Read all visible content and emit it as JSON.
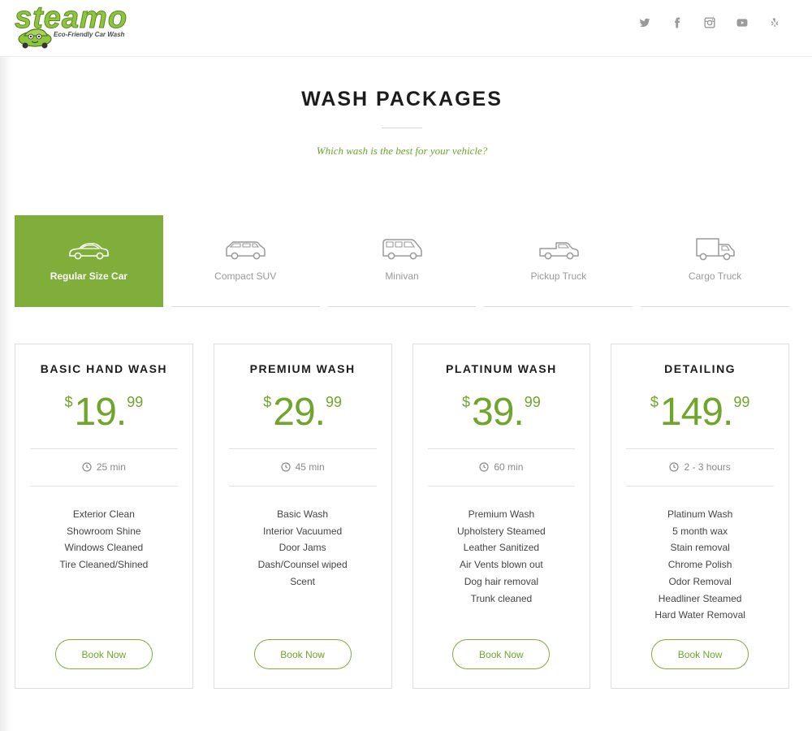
{
  "brand": {
    "name": "steamo",
    "tagline": "Eco-Friendly Car Wash",
    "color": "#8cc63f"
  },
  "social": [
    {
      "name": "twitter-icon"
    },
    {
      "name": "facebook-icon"
    },
    {
      "name": "instagram-icon"
    },
    {
      "name": "youtube-icon"
    },
    {
      "name": "yelp-icon"
    }
  ],
  "page": {
    "title": "WASH PACKAGES",
    "subtitle": "Which wash is the best for your vehicle?"
  },
  "tabs": [
    {
      "label": "Regular Size Car",
      "active": true,
      "icon": "sedan-icon"
    },
    {
      "label": "Compact SUV",
      "active": false,
      "icon": "suv-icon"
    },
    {
      "label": "Minivan",
      "active": false,
      "icon": "minivan-icon"
    },
    {
      "label": "Pickup Truck",
      "active": false,
      "icon": "pickup-truck-icon"
    },
    {
      "label": "Cargo Truck",
      "active": false,
      "icon": "cargo-truck-icon"
    }
  ],
  "packages": [
    {
      "title": "BASIC HAND WASH",
      "currency": "$",
      "price_whole": "19.",
      "price_cents": "99",
      "duration": "25 min",
      "features": [
        "Exterior Clean",
        "Showroom Shine",
        "Windows Cleaned",
        "Tire Cleaned/Shined"
      ],
      "button": "Book Now"
    },
    {
      "title": "PREMIUM WASH",
      "currency": "$",
      "price_whole": "29.",
      "price_cents": "99",
      "duration": "45 min",
      "features": [
        "Basic Wash",
        "Interior Vacuumed",
        "Door Jams",
        "Dash/Counsel wiped",
        "Scent"
      ],
      "button": "Book Now"
    },
    {
      "title": "PLATINUM WASH",
      "currency": "$",
      "price_whole": "39.",
      "price_cents": "99",
      "duration": "60 min",
      "features": [
        "Premium Wash",
        "Upholstery Steamed",
        "Leather Sanitized",
        "Air Vents blown out",
        "Dog hair removal",
        "Trunk cleaned"
      ],
      "button": "Book Now"
    },
    {
      "title": "DETAILING",
      "currency": "$",
      "price_whole": "149.",
      "price_cents": "99",
      "duration": "2 - 3 hours",
      "features": [
        "Platinum Wash",
        "5 month wax",
        "Stain removal",
        "Chrome Polish",
        "Odor Removal",
        "Headliner Steamed",
        "Hard Water Removal"
      ],
      "button": "Book Now"
    }
  ],
  "colors": {
    "accent": "#7fae3a",
    "price": "#6fa52b",
    "icon_gray": "#9a9a9a"
  }
}
